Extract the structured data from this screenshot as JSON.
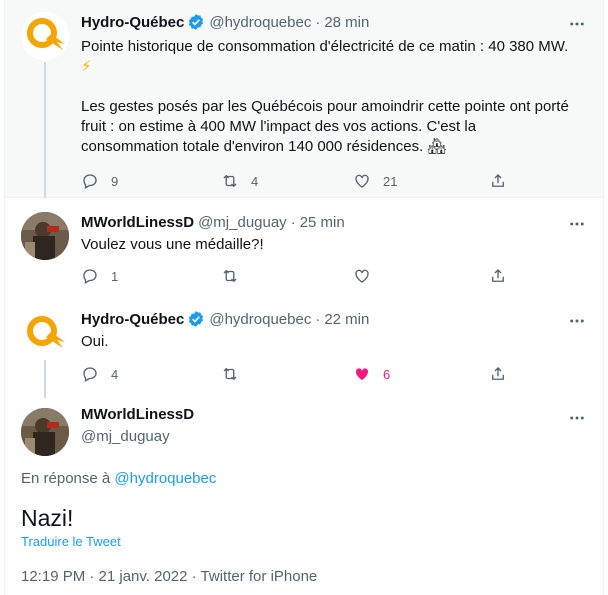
{
  "tweets": [
    {
      "name": "Hydro-Québec",
      "handle": "@hydroquebec",
      "dot": "·",
      "time": "28 min",
      "line1": "Pointe historique de consommation d'électricité de ce matin : 40 380 MW.",
      "line2": "⚡",
      "line3": "Les gestes posés par les Québécois pour amoindrir cette pointe ont porté",
      "line4": "fruit : on estime à 400 MW l'impact des vos actions. C'est la",
      "line5": "consommation totale d'environ 140 000 résidences. 🏘",
      "replies": "9",
      "retweets": "4",
      "likes": "21"
    },
    {
      "name": "MWorldLinessD",
      "handle": "@mj_duguay",
      "dot": "·",
      "time": "25 min",
      "text": "Voulez vous une médaille?!",
      "replies": "1"
    },
    {
      "name": "Hydro-Québec",
      "handle": "@hydroquebec",
      "dot": "·",
      "time": "22 min",
      "text": "Oui.",
      "replies": "4",
      "likes": "6"
    }
  ],
  "main": {
    "name": "MWorldLinessD",
    "handle": "@mj_duguay",
    "reply_prefix": "En réponse à ",
    "reply_handle": "@hydroquebec",
    "text": "Nazi!",
    "translate": "Traduire le Tweet",
    "meta": "12:19 PM · 21 janv. 2022 · Twitter for iPhone"
  },
  "colors": {
    "accent": "#1d9bf0",
    "like": "#f91880",
    "hq_orange": "#f5a400",
    "muted": "#536471"
  },
  "icons": [
    "verified-badge-icon",
    "more-icon",
    "reply-icon",
    "retweet-icon",
    "like-icon",
    "share-icon",
    "hydro-quebec-logo"
  ]
}
